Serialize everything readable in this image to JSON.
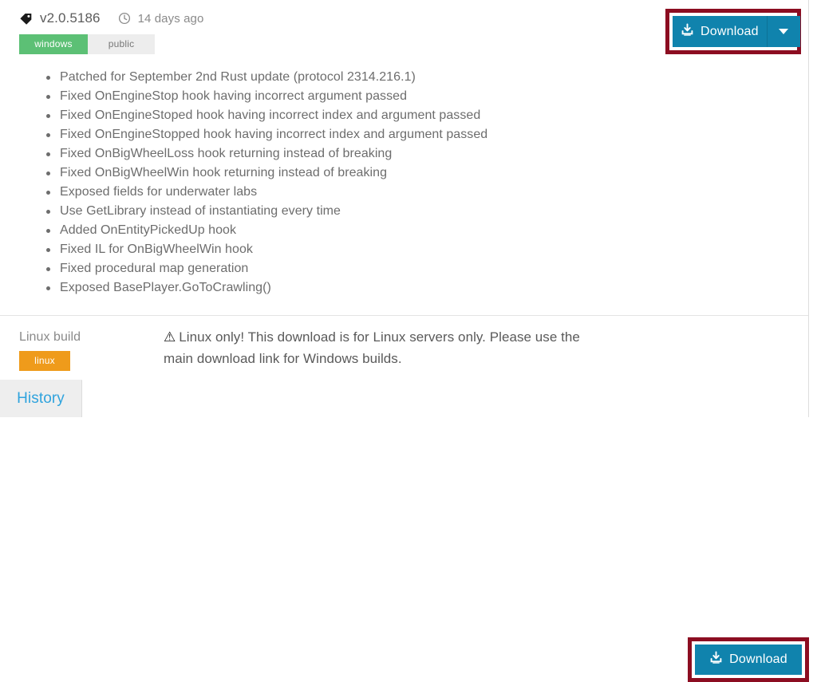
{
  "release": {
    "tag_icon": "tag-icon",
    "version": "v2.0.5186",
    "clock_icon": "clock-icon",
    "age": "14 days ago",
    "badges": [
      {
        "label": "windows",
        "color": "#5cc075"
      },
      {
        "label": "public",
        "color": "#ededed"
      }
    ]
  },
  "primary_download": {
    "icon": "download-icon",
    "label": "Download",
    "caret_icon": "caret-down-icon",
    "button_color": "#1083ad",
    "highlight_color": "#8c0d21"
  },
  "changelog": {
    "items": [
      "Patched for September 2nd Rust update (protocol 2314.216.1)",
      "Fixed OnEngineStop hook having incorrect argument passed",
      "Fixed OnEngineStoped hook having incorrect index and argument passed",
      "Fixed OnEngineStopped hook having incorrect index and argument passed",
      "Fixed OnBigWheelLoss hook returning instead of breaking",
      "Fixed OnBigWheelWin hook returning instead of breaking",
      "Exposed fields for underwater labs",
      "Use GetLibrary instead of instantiating every time",
      "Added OnEntityPickedUp hook",
      "Fixed IL for OnBigWheelWin hook",
      "Fixed procedural map generation",
      "Exposed BasePlayer.GoToCrawling()"
    ]
  },
  "linux_section": {
    "title": "Linux build",
    "badge": {
      "label": "linux",
      "color": "#ef9b1b"
    },
    "warning_icon": "warning-triangle-icon",
    "warning_text": "Linux only! This download is for Linux servers only. Please use the main download link for Windows builds.",
    "download": {
      "icon": "download-icon",
      "label": "Download",
      "button_color": "#1083ad",
      "highlight_color": "#8c0d21"
    }
  },
  "tabs": {
    "history_label": "History"
  }
}
